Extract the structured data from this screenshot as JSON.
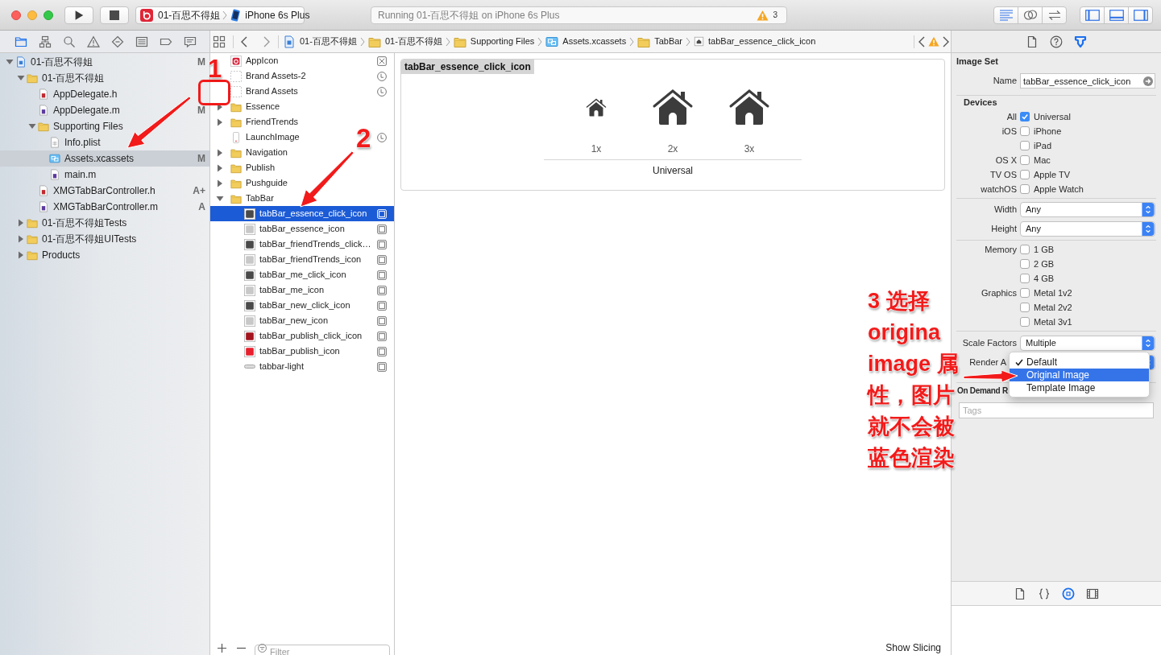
{
  "toolbar": {
    "scheme": {
      "app": "01-百思不得姐",
      "device": "iPhone 6s Plus"
    },
    "activity": {
      "text": "Running 01-百思不得姐 on iPhone 6s Plus",
      "warnings": "3"
    },
    "editor_modes": [
      {
        "kind": "standard",
        "selected": true
      },
      {
        "kind": "assistant",
        "selected": false
      },
      {
        "kind": "version",
        "selected": false
      }
    ],
    "panels": [
      {
        "kind": "navigator",
        "on": true
      },
      {
        "kind": "debug",
        "on": true
      },
      {
        "kind": "utilities",
        "on": true
      }
    ]
  },
  "navigator": {
    "tabs": [
      {
        "kind": "project",
        "selected": true
      },
      {
        "kind": "symbol",
        "selected": false
      },
      {
        "kind": "find",
        "selected": false
      },
      {
        "kind": "issue",
        "selected": false
      },
      {
        "kind": "test",
        "selected": false
      },
      {
        "kind": "debug",
        "selected": false
      },
      {
        "kind": "breakpoint",
        "selected": false
      },
      {
        "kind": "report",
        "selected": false
      }
    ],
    "tree": [
      {
        "label": "01-百思不得姐",
        "kind": "project",
        "status": "M",
        "expanded": true,
        "selected": false,
        "children": [
          {
            "label": "01-百思不得姐",
            "kind": "folder",
            "expanded": true,
            "selected": false,
            "children": [
              {
                "label": "AppDelegate.h",
                "kind": "header",
                "selected": false
              },
              {
                "label": "AppDelegate.m",
                "kind": "source",
                "status": "M",
                "selected": false
              },
              {
                "label": "Supporting Files",
                "kind": "folder",
                "expanded": true,
                "selected": false,
                "children": [
                  {
                    "label": "Info.plist",
                    "kind": "plist",
                    "selected": false
                  },
                  {
                    "label": "Assets.xcassets",
                    "kind": "assets",
                    "status": "M",
                    "selected": true
                  },
                  {
                    "label": "main.m",
                    "kind": "source",
                    "selected": false
                  }
                ]
              },
              {
                "label": "XMGTabBarController.h",
                "kind": "header",
                "status": "A+",
                "selected": false
              },
              {
                "label": "XMGTabBarController.m",
                "kind": "source",
                "status": "A",
                "selected": false
              }
            ]
          },
          {
            "label": "01-百思不得姐Tests",
            "kind": "folder",
            "expanded": false,
            "selected": false
          },
          {
            "label": "01-百思不得姐UITests",
            "kind": "folder",
            "expanded": false,
            "selected": false
          },
          {
            "label": "Products",
            "kind": "folder",
            "expanded": false,
            "selected": false
          }
        ]
      }
    ]
  },
  "jump_bar": {
    "path": [
      {
        "kind": "project",
        "label": "01-百思不得姐"
      },
      {
        "kind": "folder",
        "label": "01-百思不得姐"
      },
      {
        "kind": "folder",
        "label": "Supporting Files"
      },
      {
        "kind": "assets",
        "label": "Assets.xcassets"
      },
      {
        "kind": "folder",
        "label": "TabBar"
      },
      {
        "kind": "imageset",
        "label": "tabBar_essence_click_icon"
      }
    ]
  },
  "asset_list": {
    "items": [
      {
        "label": "AppIcon",
        "kind": "appicon",
        "selected": false
      },
      {
        "label": "Brand Assets-2",
        "kind": "brand",
        "selected": false
      },
      {
        "label": "Brand Assets",
        "kind": "brand",
        "selected": false
      },
      {
        "label": "Essence",
        "kind": "folder",
        "expanded": false,
        "selected": false
      },
      {
        "label": "FriendTrends",
        "kind": "folder",
        "expanded": false,
        "selected": false
      },
      {
        "label": "LaunchImage",
        "kind": "launch",
        "selected": false
      },
      {
        "label": "Navigation",
        "kind": "folder",
        "expanded": false,
        "selected": false
      },
      {
        "label": "Publish",
        "kind": "folder",
        "expanded": false,
        "selected": false
      },
      {
        "label": "Pushguide",
        "kind": "folder",
        "expanded": false,
        "selected": false
      },
      {
        "label": "TabBar",
        "kind": "folder",
        "expanded": true,
        "selected": false,
        "children": [
          {
            "label": "tabBar_essence_click_icon",
            "kind": "imageset",
            "color": "#4a4a4a",
            "selected": true
          },
          {
            "label": "tabBar_essence_icon",
            "kind": "imageset",
            "color": "#c8c8c8",
            "selected": false
          },
          {
            "label": "tabBar_friendTrends_click…",
            "kind": "imageset",
            "color": "#4a4a4a",
            "selected": false
          },
          {
            "label": "tabBar_friendTrends_icon",
            "kind": "imageset",
            "color": "#c8c8c8",
            "selected": false
          },
          {
            "label": "tabBar_me_click_icon",
            "kind": "imageset",
            "color": "#4a4a4a",
            "selected": false
          },
          {
            "label": "tabBar_me_icon",
            "kind": "imageset",
            "color": "#c8c8c8",
            "selected": false
          },
          {
            "label": "tabBar_new_click_icon",
            "kind": "imageset",
            "color": "#4a4a4a",
            "selected": false
          },
          {
            "label": "tabBar_new_icon",
            "kind": "imageset",
            "color": "#c8c8c8",
            "selected": false
          },
          {
            "label": "tabBar_publish_click_icon",
            "kind": "imageset",
            "color": "#a3141e",
            "selected": false
          },
          {
            "label": "tabBar_publish_icon",
            "kind": "imageset",
            "color": "#e8202e",
            "selected": false
          },
          {
            "label": "tabbar-light",
            "kind": "strip",
            "color": "#dcdcdc",
            "selected": false
          }
        ]
      }
    ],
    "filter": {
      "placeholder": "Filter"
    }
  },
  "editor": {
    "title": "tabBar_essence_click_icon",
    "slots": [
      {
        "label": "1x",
        "kind": "small"
      },
      {
        "label": "2x",
        "kind": "large"
      },
      {
        "label": "3x",
        "kind": "large"
      }
    ],
    "group": "Universal",
    "footer_button": "Show Slicing"
  },
  "inspector": {
    "tabs": [
      {
        "kind": "file",
        "selected": false
      },
      {
        "kind": "help",
        "selected": false
      },
      {
        "kind": "attributes",
        "selected": true
      }
    ],
    "section_title": "Image Set",
    "name": {
      "label": "Name",
      "value": "tabBar_essence_click_icon"
    },
    "devices": {
      "title": "Devices",
      "options": [
        {
          "label": "All",
          "option": "Universal",
          "checked": true
        },
        {
          "label": "iOS",
          "option": "iPhone",
          "checked": false
        },
        {
          "option": "iPad",
          "checked": false
        },
        {
          "label": "OS X",
          "option": "Mac",
          "checked": false
        },
        {
          "label": "TV OS",
          "option": "Apple TV",
          "checked": false
        },
        {
          "label": "watchOS",
          "option": "Apple Watch",
          "checked": false
        }
      ]
    },
    "size": [
      {
        "label": "Width",
        "value": "Any"
      },
      {
        "label": "Height",
        "value": "Any"
      }
    ],
    "requirements": [
      {
        "label": "Memory",
        "option": "1 GB",
        "checked": false
      },
      {
        "option": "2 GB",
        "checked": false
      },
      {
        "option": "4 GB",
        "checked": false
      },
      {
        "label": "Graphics",
        "option": "Metal 1v2",
        "checked": false
      },
      {
        "option": "Metal 2v2",
        "checked": false
      },
      {
        "option": "Metal 3v1",
        "checked": false
      }
    ],
    "scale_factors": {
      "label": "Scale Factors",
      "value": "Multiple"
    },
    "render_as": {
      "label": "Render A",
      "menu": [
        {
          "label": "Default",
          "checked": true,
          "highlighted": false
        },
        {
          "label": "Original Image",
          "checked": false,
          "highlighted": true
        },
        {
          "label": "Template Image",
          "checked": false,
          "highlighted": false
        }
      ]
    },
    "on_demand": {
      "title": "On Demand R",
      "tags": {
        "placeholder": "Tags"
      }
    },
    "library_tabs": [
      {
        "kind": "file-template",
        "selected": false
      },
      {
        "kind": "code-snippet",
        "selected": false
      },
      {
        "kind": "object",
        "selected": true
      },
      {
        "kind": "media",
        "selected": false
      }
    ]
  },
  "annotations": [
    {
      "kind": "boxed",
      "label": "1"
    },
    {
      "kind": "plain",
      "label": "2"
    },
    {
      "kind": "note",
      "text": "3 选择 origina image 属性，图片就不会被蓝色渲染"
    }
  ]
}
